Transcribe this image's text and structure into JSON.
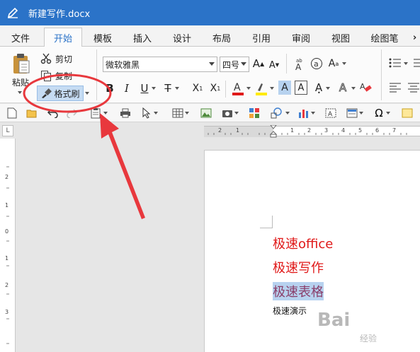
{
  "window": {
    "title": "新建写作.docx"
  },
  "menu": {
    "tabs": [
      {
        "label": "文件"
      },
      {
        "label": "开始"
      },
      {
        "label": "模板"
      },
      {
        "label": "插入"
      },
      {
        "label": "设计"
      },
      {
        "label": "布局"
      },
      {
        "label": "引用"
      },
      {
        "label": "审阅"
      },
      {
        "label": "视图"
      },
      {
        "label": "绘图笔"
      }
    ],
    "active_tab": "开始"
  },
  "clipboard": {
    "paste_label": "粘贴",
    "cut_label": "剪切",
    "copy_label": "复制",
    "format_painter_label": "格式刷"
  },
  "font": {
    "family_value": "微软雅黑",
    "size_value": "四号"
  },
  "document": {
    "lines": [
      {
        "text": "极速office"
      },
      {
        "text": "极速写作"
      },
      {
        "text": "极速表格"
      },
      {
        "text": "极速演示"
      }
    ]
  },
  "ruler": {
    "h_ticks": [
      "2",
      "1",
      "1",
      "2",
      "3",
      "4",
      "5",
      "6",
      "7"
    ],
    "v_ticks": [
      "2",
      "1",
      "0",
      "1",
      "2",
      "3"
    ]
  },
  "annotation": {
    "color": "#e8383d"
  },
  "watermark": {
    "text": "Bai",
    "sub": "经验"
  }
}
